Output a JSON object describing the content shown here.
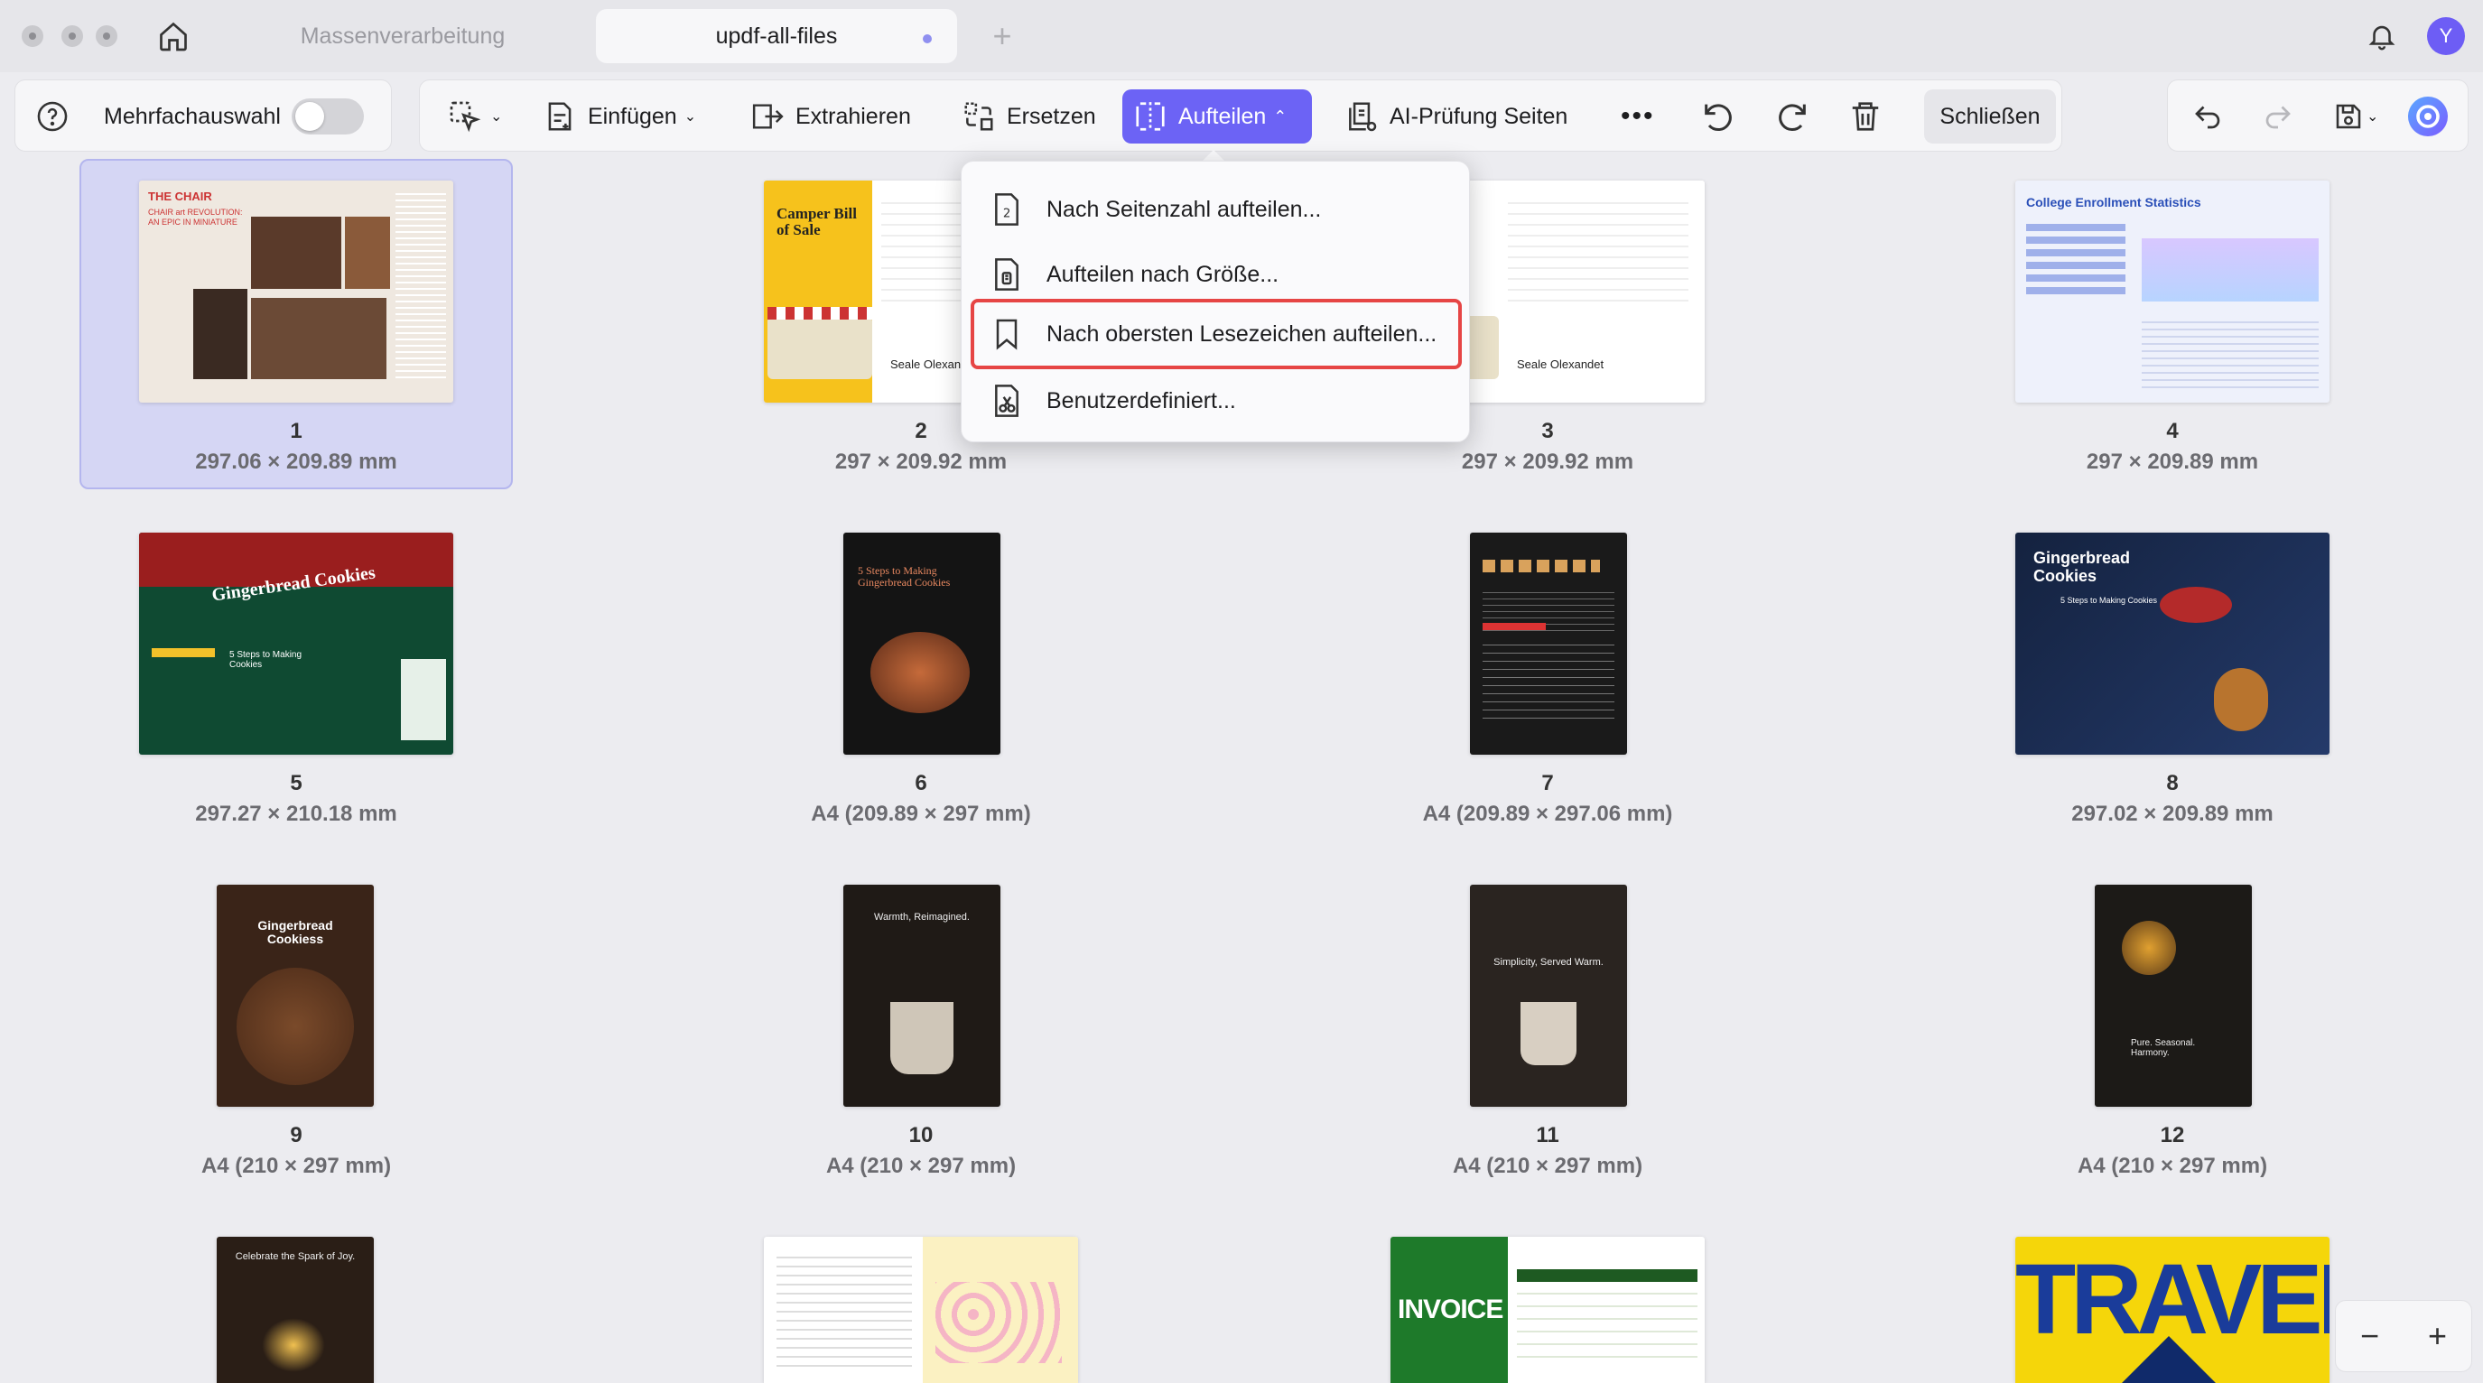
{
  "titlebar": {
    "tabs": [
      {
        "label": "Massenverarbeitung"
      },
      {
        "label": "updf-all-files"
      }
    ],
    "avatar_letter": "Y"
  },
  "toolbar": {
    "multi_select_label": "Mehrfachauswahl",
    "insert_label": "Einfügen",
    "extract_label": "Extrahieren",
    "replace_label": "Ersetzen",
    "split_label": "Aufteilen",
    "ai_check_label": "AI-Prüfung Seiten",
    "close_label": "Schließen"
  },
  "split_menu": {
    "items": [
      {
        "label": "Nach Seitenzahl aufteilen..."
      },
      {
        "label": "Aufteilen nach Größe..."
      },
      {
        "label": "Nach obersten Lesezeichen aufteilen..."
      },
      {
        "label": "Benutzerdefiniert..."
      }
    ]
  },
  "pages": [
    {
      "num": "1",
      "size": "297.06 × 209.89 mm",
      "title": "THE CHAIR",
      "sub": "CHAIR art REVOLUTION: AN EPIC IN MINIATURE"
    },
    {
      "num": "2",
      "size": "297 × 209.92 mm",
      "title": "Camper Bill of Sale",
      "sub": "Seale Olexandet"
    },
    {
      "num": "3",
      "size": "297 × 209.92 mm",
      "title": "",
      "sub": "Seale Olexandet"
    },
    {
      "num": "4",
      "size": "297 × 209.89 mm",
      "title": "College Enrollment Statistics",
      "sub": ""
    },
    {
      "num": "5",
      "size": "297.27 × 210.18 mm",
      "title": "Gingerbread Cookies",
      "sub": "5 Steps to Making Cookies"
    },
    {
      "num": "6",
      "size": "A4 (209.89 × 297 mm)",
      "title": "5 Steps to Making Gingerbread Cookies",
      "sub": ""
    },
    {
      "num": "7",
      "size": "A4 (209.89 × 297.06 mm)",
      "title": "",
      "sub": ""
    },
    {
      "num": "8",
      "size": "297.02 × 209.89 mm",
      "title": "Gingerbread Cookies",
      "sub": "5 Steps to Making Cookies"
    },
    {
      "num": "9",
      "size": "A4 (210 × 297 mm)",
      "title": "Gingerbread Cookiess",
      "sub": ""
    },
    {
      "num": "10",
      "size": "A4 (210 × 297 mm)",
      "title": "Warmth, Reimagined.",
      "sub": ""
    },
    {
      "num": "11",
      "size": "A4 (210 × 297 mm)",
      "title": "Simplicity, Served Warm.",
      "sub": ""
    },
    {
      "num": "12",
      "size": "A4 (210 × 297 mm)",
      "title": "Pure. Seasonal. Harmony.",
      "sub": ""
    },
    {
      "num": "",
      "size": "",
      "title": "Celebrate the Spark of Joy.",
      "sub": ""
    },
    {
      "num": "",
      "size": "",
      "title": "",
      "sub": ""
    },
    {
      "num": "",
      "size": "",
      "title": "INVOICE",
      "sub": ""
    },
    {
      "num": "",
      "size": "",
      "title": "TRAVEL",
      "sub": ""
    }
  ],
  "zoom": {
    "minus": "−",
    "plus": "+"
  }
}
